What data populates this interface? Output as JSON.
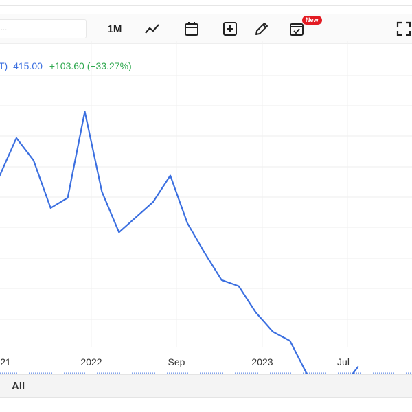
{
  "toolbar": {
    "search_text": "...",
    "range_label": "1M",
    "new_badge": "New",
    "icons": [
      "line-chart-icon",
      "calendar-icon",
      "add-indicator-icon",
      "pencil-icon",
      "calendar-check-icon",
      "fullscreen-icon"
    ]
  },
  "legend": {
    "symbol_fragment": "T)",
    "price": "415.00",
    "change": "+103.60 (+33.27%)",
    "price_color": "#3b6fe0",
    "change_color": "#2fa84f"
  },
  "chart_data": {
    "type": "line",
    "x_tick_labels": [
      "21",
      "2022",
      "Sep",
      "2023",
      "Jul"
    ],
    "series": [
      {
        "values": [
          505,
          543,
          521,
          474,
          484,
          569,
          490,
          450,
          465,
          480,
          506,
          459,
          430,
          403,
          397,
          371,
          352,
          343,
          310,
          299,
          296,
          318
        ]
      }
    ],
    "reference_value": 311.4,
    "line_color": "#3b6fe0",
    "grid": true
  },
  "bottom": {
    "range_all_label": "All"
  }
}
